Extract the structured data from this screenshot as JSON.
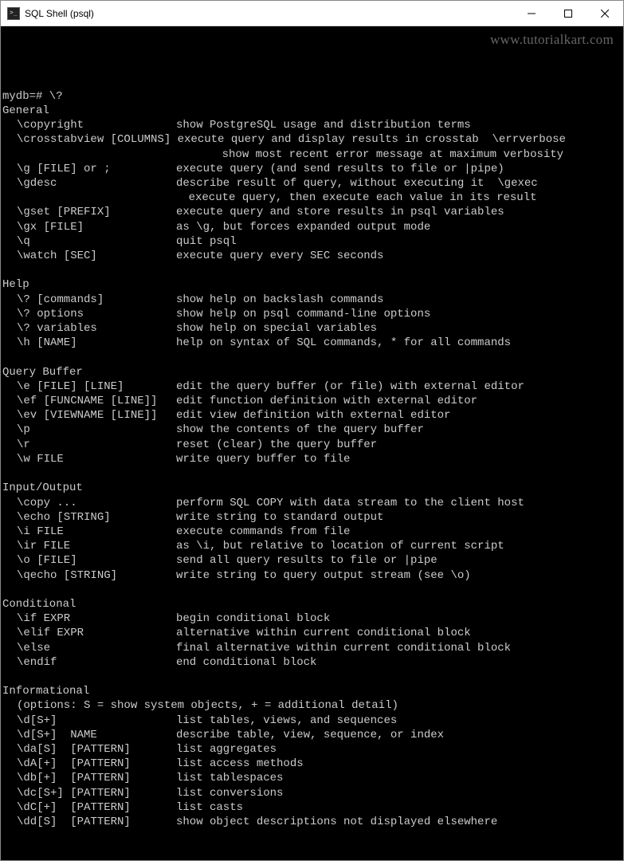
{
  "window": {
    "title": "SQL Shell (psql)"
  },
  "watermark": "www.tutorialkart.com",
  "prompt": "mydb=# \\?",
  "sections": [
    {
      "header": "General",
      "items": [
        {
          "cmd": "\\copyright",
          "desc": "show PostgreSQL usage and distribution terms"
        },
        {
          "cmd": "\\crosstabview [COLUMNS]",
          "desc": "execute query and display results in crosstab  \\errverbose",
          "nowidth": true,
          "sep": " "
        },
        {
          "cmd": "",
          "desc": "         show most recent error message at maximum verbosity",
          "cont": true
        },
        {
          "cmd": "\\g [FILE] or ;",
          "desc": "execute query (and send results to file or |pipe)"
        },
        {
          "cmd": "\\gdesc",
          "desc": "describe result of query, without executing it  \\gexec"
        },
        {
          "cmd": "",
          "desc": "    execute query, then execute each value in its result",
          "cont": true
        },
        {
          "cmd": "\\gset [PREFIX]",
          "desc": "execute query and store results in psql variables"
        },
        {
          "cmd": "\\gx [FILE]",
          "desc": "as \\g, but forces expanded output mode"
        },
        {
          "cmd": "\\q",
          "desc": "quit psql"
        },
        {
          "cmd": "\\watch [SEC]",
          "desc": "execute query every SEC seconds"
        }
      ]
    },
    {
      "header": "Help",
      "items": [
        {
          "cmd": "\\? [commands]",
          "desc": "show help on backslash commands"
        },
        {
          "cmd": "\\? options",
          "desc": "show help on psql command-line options"
        },
        {
          "cmd": "\\? variables",
          "desc": "show help on special variables"
        },
        {
          "cmd": "\\h [NAME]",
          "desc": "help on syntax of SQL commands, * for all commands"
        }
      ]
    },
    {
      "header": "Query Buffer",
      "items": [
        {
          "cmd": "\\e [FILE] [LINE]",
          "desc": "edit the query buffer (or file) with external editor"
        },
        {
          "cmd": "\\ef [FUNCNAME [LINE]]",
          "desc": "edit function definition with external editor"
        },
        {
          "cmd": "\\ev [VIEWNAME [LINE]]",
          "desc": "edit view definition with external editor"
        },
        {
          "cmd": "\\p",
          "desc": "show the contents of the query buffer"
        },
        {
          "cmd": "\\r",
          "desc": "reset (clear) the query buffer"
        },
        {
          "cmd": "\\w FILE",
          "desc": "write query buffer to file"
        }
      ]
    },
    {
      "header": "Input/Output",
      "items": [
        {
          "cmd": "\\copy ...",
          "desc": "perform SQL COPY with data stream to the client host"
        },
        {
          "cmd": "\\echo [STRING]",
          "desc": "write string to standard output"
        },
        {
          "cmd": "\\i FILE",
          "desc": "execute commands from file"
        },
        {
          "cmd": "\\ir FILE",
          "desc": "as \\i, but relative to location of current script"
        },
        {
          "cmd": "\\o [FILE]",
          "desc": "send all query results to file or |pipe"
        },
        {
          "cmd": "\\qecho [STRING]",
          "desc": "write string to query output stream (see \\o)"
        }
      ]
    },
    {
      "header": "Conditional",
      "items": [
        {
          "cmd": "\\if EXPR",
          "desc": "begin conditional block"
        },
        {
          "cmd": "\\elif EXPR",
          "desc": "alternative within current conditional block"
        },
        {
          "cmd": "\\else",
          "desc": "final alternative within current conditional block"
        },
        {
          "cmd": "\\endif",
          "desc": "end conditional block"
        }
      ]
    },
    {
      "header": "Informational",
      "note": "(options: S = show system objects, + = additional detail)",
      "items": [
        {
          "cmd": "\\d[S+]",
          "desc": "list tables, views, and sequences"
        },
        {
          "cmd": "\\d[S+]  NAME",
          "desc": "describe table, view, sequence, or index"
        },
        {
          "cmd": "\\da[S]  [PATTERN]",
          "desc": "list aggregates"
        },
        {
          "cmd": "\\dA[+]  [PATTERN]",
          "desc": "list access methods"
        },
        {
          "cmd": "\\db[+]  [PATTERN]",
          "desc": "list tablespaces"
        },
        {
          "cmd": "\\dc[S+] [PATTERN]",
          "desc": "list conversions"
        },
        {
          "cmd": "\\dC[+]  [PATTERN]",
          "desc": "list casts"
        },
        {
          "cmd": "\\dd[S]  [PATTERN]",
          "desc": "show object descriptions not displayed elsewhere"
        }
      ]
    }
  ]
}
